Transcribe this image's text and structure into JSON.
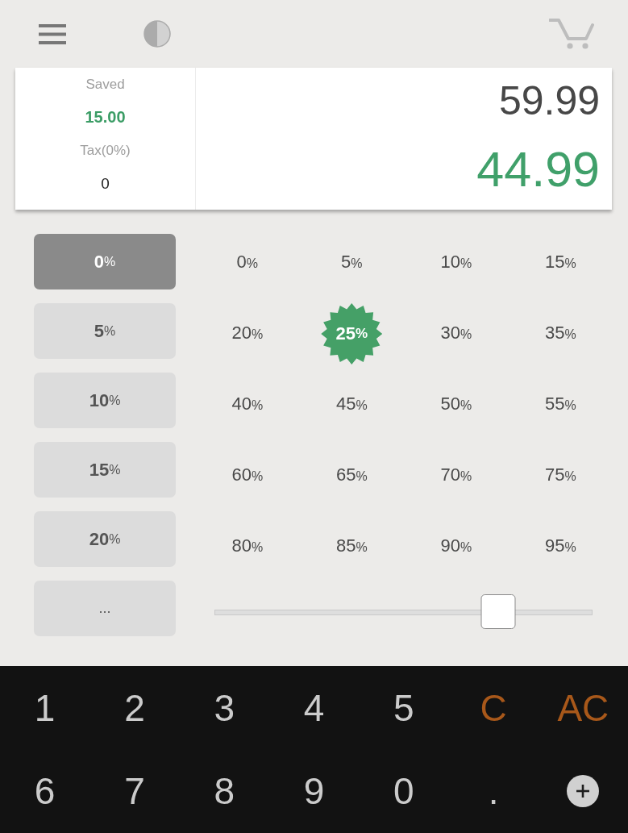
{
  "summary": {
    "saved_label": "Saved",
    "saved_value": "15.00",
    "tax_label": "Tax(0%)",
    "tax_value": "0",
    "original_price": "59.99",
    "final_price": "44.99"
  },
  "tax_rates": [
    {
      "kind": "rate",
      "value": "0",
      "unit": "%",
      "selected": true
    },
    {
      "kind": "rate",
      "value": "5",
      "unit": "%",
      "selected": false
    },
    {
      "kind": "rate",
      "value": "10",
      "unit": "%",
      "selected": false
    },
    {
      "kind": "rate",
      "value": "15",
      "unit": "%",
      "selected": false
    },
    {
      "kind": "rate",
      "value": "20",
      "unit": "%",
      "selected": false
    },
    {
      "kind": "more",
      "value": "...",
      "selected": false
    }
  ],
  "discounts": [
    {
      "value": "0",
      "unit": "%",
      "selected": false
    },
    {
      "value": "5",
      "unit": "%",
      "selected": false
    },
    {
      "value": "10",
      "unit": "%",
      "selected": false
    },
    {
      "value": "15",
      "unit": "%",
      "selected": false
    },
    {
      "value": "20",
      "unit": "%",
      "selected": false
    },
    {
      "value": "25",
      "unit": "%",
      "selected": true
    },
    {
      "value": "30",
      "unit": "%",
      "selected": false
    },
    {
      "value": "35",
      "unit": "%",
      "selected": false
    },
    {
      "value": "40",
      "unit": "%",
      "selected": false
    },
    {
      "value": "45",
      "unit": "%",
      "selected": false
    },
    {
      "value": "50",
      "unit": "%",
      "selected": false
    },
    {
      "value": "55",
      "unit": "%",
      "selected": false
    },
    {
      "value": "60",
      "unit": "%",
      "selected": false
    },
    {
      "value": "65",
      "unit": "%",
      "selected": false
    },
    {
      "value": "70",
      "unit": "%",
      "selected": false
    },
    {
      "value": "75",
      "unit": "%",
      "selected": false
    },
    {
      "value": "80",
      "unit": "%",
      "selected": false
    },
    {
      "value": "85",
      "unit": "%",
      "selected": false
    },
    {
      "value": "90",
      "unit": "%",
      "selected": false
    },
    {
      "value": "95",
      "unit": "%",
      "selected": false
    }
  ],
  "discount_slider": {
    "level": 0.75
  },
  "keypad": [
    {
      "kind": "digit",
      "label": "1"
    },
    {
      "kind": "digit",
      "label": "2"
    },
    {
      "kind": "digit",
      "label": "3"
    },
    {
      "kind": "digit",
      "label": "4"
    },
    {
      "kind": "digit",
      "label": "5"
    },
    {
      "kind": "clear",
      "label": "C"
    },
    {
      "kind": "clear",
      "label": "AC"
    },
    {
      "kind": "digit",
      "label": "6"
    },
    {
      "kind": "digit",
      "label": "7"
    },
    {
      "kind": "digit",
      "label": "8"
    },
    {
      "kind": "digit",
      "label": "9"
    },
    {
      "kind": "digit",
      "label": "0"
    },
    {
      "kind": "digit",
      "label": "."
    },
    {
      "kind": "add"
    }
  ]
}
